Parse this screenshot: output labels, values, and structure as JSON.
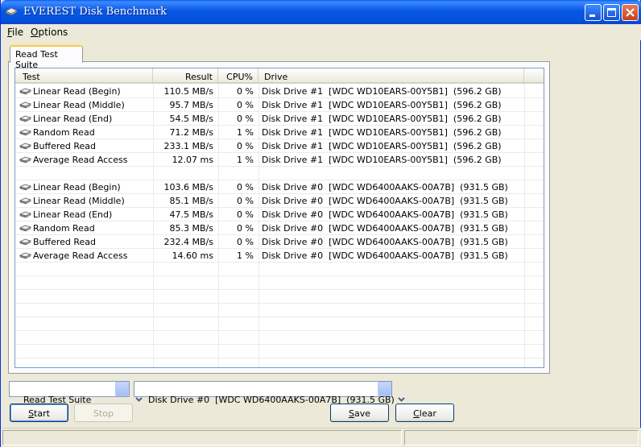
{
  "window": {
    "title": "EVEREST Disk Benchmark"
  },
  "menu": {
    "file": "ile",
    "file_key": "F",
    "options": "ptions",
    "options_key": "O"
  },
  "tab": {
    "label": "Read Test Suite"
  },
  "columns": [
    "Test",
    "Result",
    "CPU%",
    "Drive"
  ],
  "rows": [
    {
      "test": "Linear Read (Begin)",
      "result": "110.5 MB/s",
      "cpu": "0 %",
      "drive": "Disk Drive #1  [WDC WD10EARS-00Y5B1]  (596.2 GB)"
    },
    {
      "test": "Linear Read (Middle)",
      "result": "95.7 MB/s",
      "cpu": "0 %",
      "drive": "Disk Drive #1  [WDC WD10EARS-00Y5B1]  (596.2 GB)"
    },
    {
      "test": "Linear Read (End)",
      "result": "54.5 MB/s",
      "cpu": "0 %",
      "drive": "Disk Drive #1  [WDC WD10EARS-00Y5B1]  (596.2 GB)"
    },
    {
      "test": "Random Read",
      "result": "71.2 MB/s",
      "cpu": "1 %",
      "drive": "Disk Drive #1  [WDC WD10EARS-00Y5B1]  (596.2 GB)"
    },
    {
      "test": "Buffered Read",
      "result": "233.1 MB/s",
      "cpu": "0 %",
      "drive": "Disk Drive #1  [WDC WD10EARS-00Y5B1]  (596.2 GB)"
    },
    {
      "test": "Average Read Access",
      "result": "12.07 ms",
      "cpu": "1 %",
      "drive": "Disk Drive #1  [WDC WD10EARS-00Y5B1]  (596.2 GB)"
    },
    {
      "test": "Linear Read (Begin)",
      "result": "103.6 MB/s",
      "cpu": "0 %",
      "drive": "Disk Drive #0  [WDC WD6400AAKS-00A7B]  (931.5 GB)"
    },
    {
      "test": "Linear Read (Middle)",
      "result": "85.1 MB/s",
      "cpu": "0 %",
      "drive": "Disk Drive #0  [WDC WD6400AAKS-00A7B]  (931.5 GB)"
    },
    {
      "test": "Linear Read (End)",
      "result": "47.5 MB/s",
      "cpu": "0 %",
      "drive": "Disk Drive #0  [WDC WD6400AAKS-00A7B]  (931.5 GB)"
    },
    {
      "test": "Random Read",
      "result": "85.3 MB/s",
      "cpu": "0 %",
      "drive": "Disk Drive #0  [WDC WD6400AAKS-00A7B]  (931.5 GB)"
    },
    {
      "test": "Buffered Read",
      "result": "232.4 MB/s",
      "cpu": "0 %",
      "drive": "Disk Drive #0  [WDC WD6400AAKS-00A7B]  (931.5 GB)"
    },
    {
      "test": "Average Read Access",
      "result": "14.60 ms",
      "cpu": "1 %",
      "drive": "Disk Drive #0  [WDC WD6400AAKS-00A7B]  (931.5 GB)"
    }
  ],
  "suite_select": {
    "value": "Read Test Suite"
  },
  "drive_select": {
    "value": "Disk Drive #0  [WDC WD6400AAKS-00A7B]  (931.5 GB)"
  },
  "buttons": {
    "start": "tart",
    "start_key": "S",
    "stop": "Stop",
    "save": "ave",
    "save_key": "S",
    "clear": "lear",
    "clear_key": "C"
  },
  "colors": {
    "titlebar": "#0756e4",
    "tab_accent": "#ffc83c",
    "list_border": "#7f9db9"
  }
}
